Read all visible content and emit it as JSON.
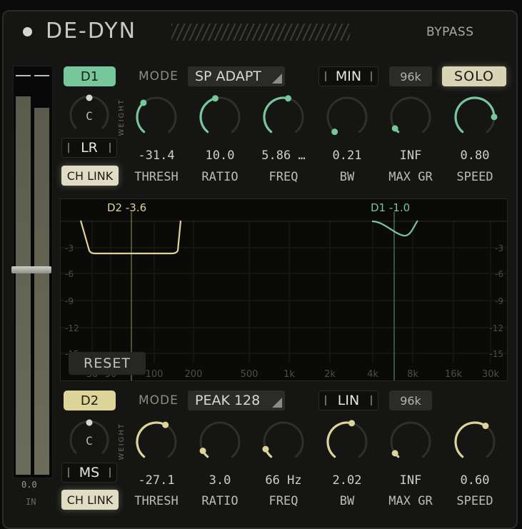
{
  "header": {
    "title": "DE-DYN",
    "bypass_label": "BYPASS"
  },
  "meter": {
    "value": "0.0",
    "label": "IN"
  },
  "colors": {
    "band1": "#77c79c",
    "band2": "#ddd49a",
    "background": "#151513"
  },
  "bands": [
    {
      "id": "D1",
      "mode_label": "MODE",
      "mode_value": "SP ADAPT",
      "phase_mode": "MIN",
      "sample_rate": "96k",
      "solo_label": "SOLO",
      "channel_mode": "LR",
      "channel_link": "CH LINK",
      "weight_label": "WEIGHT",
      "weight_knob_label": "C",
      "knobs": [
        {
          "value": "-31.4",
          "label": "THRESH",
          "level": 0.35
        },
        {
          "value": "10.0",
          "label": "RATIO",
          "level": 0.45
        },
        {
          "value": "5.86 …",
          "label": "FREQ",
          "level": 0.55
        },
        {
          "value": "0.21",
          "label": "BW",
          "level": 0.0
        },
        {
          "value": "INF",
          "label": "MAX GR",
          "level": 0.05
        },
        {
          "value": "0.80",
          "label": "SPEED",
          "level": 0.82
        }
      ]
    },
    {
      "id": "D2",
      "mode_label": "MODE",
      "mode_value": "PEAK 128",
      "phase_mode": "LIN",
      "sample_rate": "96k",
      "channel_mode": "MS",
      "channel_link": "CH LINK",
      "weight_label": "WEIGHT",
      "weight_knob_label": "C",
      "knobs": [
        {
          "value": "-27.1",
          "label": "THRESH",
          "level": 0.6
        },
        {
          "value": "3.0",
          "label": "RATIO",
          "level": 0.08
        },
        {
          "value": "66 Hz",
          "label": "FREQ",
          "level": 0.1
        },
        {
          "value": "2.02",
          "label": "BW",
          "level": 0.55
        },
        {
          "value": "INF",
          "label": "MAX GR",
          "level": 0.05
        },
        {
          "value": "0.60",
          "label": "SPEED",
          "level": 0.62
        }
      ]
    }
  ],
  "graph": {
    "band2_tag": "D2 -3.6",
    "band1_tag": "D1 -1.0",
    "reset_label": "RESET",
    "db_labels": [
      "-3",
      "-6",
      "-9",
      "-12",
      "-15"
    ],
    "freq_labels": [
      "30",
      "50",
      "100",
      "200",
      "500",
      "1k",
      "2k",
      "4k",
      "8k",
      "16k",
      "30k"
    ]
  }
}
